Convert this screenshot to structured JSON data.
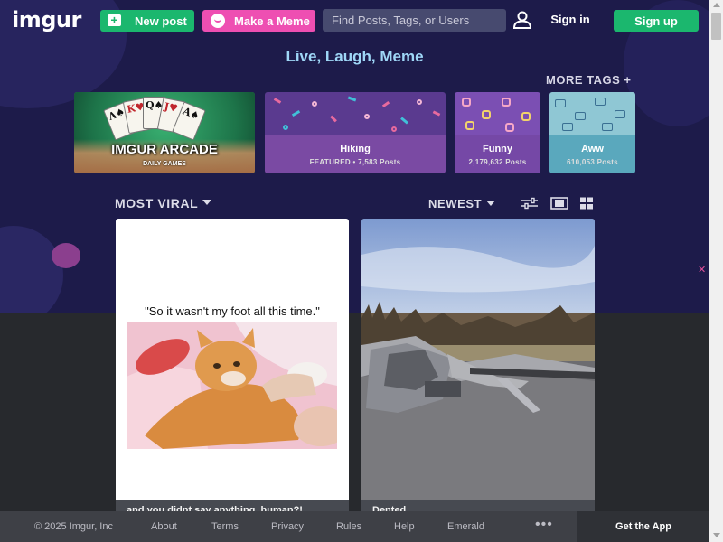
{
  "header": {
    "logo_text": "imgur",
    "new_post_label": "New post",
    "make_meme_label": "Make a Meme",
    "search_placeholder": "Find Posts, Tags, or Users",
    "sign_in_label": "Sign in",
    "sign_up_label": "Sign up"
  },
  "tagline": "Live, Laugh, Meme",
  "more_tags_label": "MORE TAGS +",
  "tags": [
    {
      "name": "IMGUR ARCADE",
      "meta": "DAILY GAMES"
    },
    {
      "name": "Hiking",
      "meta": "FEATURED • 7,583 Posts"
    },
    {
      "name": "Funny",
      "meta": "2,179,632 Posts"
    },
    {
      "name": "Aww",
      "meta": "610,053 Posts"
    }
  ],
  "sort": {
    "section_label": "MOST VIRAL",
    "order_label": "NEWEST"
  },
  "posts": [
    {
      "quote": "\"So it wasn't my foot all this time.\"",
      "caption": "and you didnt say anything, human?!"
    },
    {
      "caption": "Dented"
    }
  ],
  "footer": {
    "copyright": "© 2025 Imgur, Inc",
    "links": [
      "About",
      "Terms",
      "Privacy",
      "Rules",
      "Help",
      "Emerald"
    ],
    "more": "•••",
    "get_app_label": "Get the App"
  },
  "colors": {
    "hero_bg": "#1d1b4a",
    "green": "#1bb76e",
    "pink": "#ee4fb2",
    "tagline": "#9fd7f7"
  }
}
